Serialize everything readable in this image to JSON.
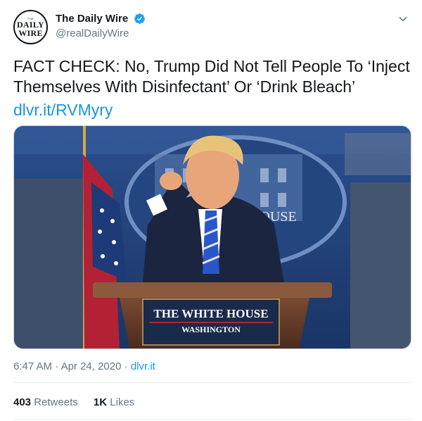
{
  "account": {
    "avatar_text_small": "THE",
    "avatar_line1": "DAILY",
    "avatar_line2": "WIRE",
    "display_name": "The Daily Wire",
    "handle": "@realDailyWire"
  },
  "tweet": {
    "text": "FACT CHECK: No, Trump Did Not Tell People To ‘Inject Themselves With Disinfectant’ Or ‘Drink Bleach’",
    "link": "dlvr.it/RVMyry"
  },
  "media": {
    "podium_line1": "THE WHITE HOUSE",
    "podium_line2": "WASHINGTON",
    "backdrop_text": "HOUSE"
  },
  "meta": {
    "time": "6:47 AM",
    "separator": "·",
    "date": "Apr 24, 2020",
    "source": "dlvr.it"
  },
  "stats": {
    "retweets_count": "403",
    "retweets_label": "Retweets",
    "likes_count": "1K",
    "likes_label": "Likes"
  },
  "colors": {
    "link_blue": "#1b95e0",
    "verified_blue": "#1da1f2",
    "secondary_text": "#657786"
  }
}
